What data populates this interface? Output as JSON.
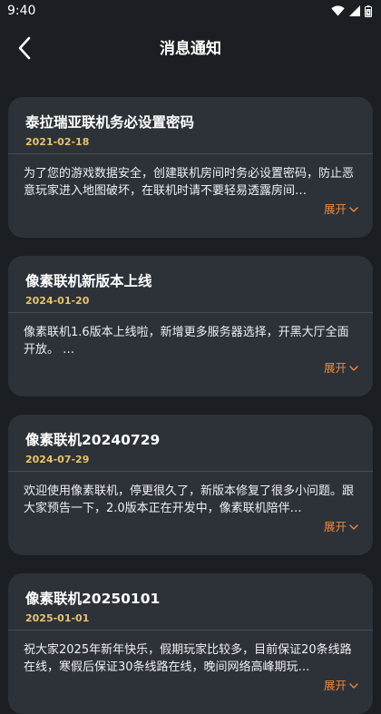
{
  "status_bar": {
    "time": "9:40",
    "icons": [
      "wifi-icon",
      "signal-icon",
      "battery-icon"
    ]
  },
  "header": {
    "title": "消息通知",
    "back_icon": "chevron-left-icon"
  },
  "colors": {
    "background": "#1b1e22",
    "card": "#2c3238",
    "date": "#e8c36a",
    "expand": "#f0883a"
  },
  "notifications": [
    {
      "title": "泰拉瑞亚联机务必设置密码",
      "date": "2021-02-18",
      "body": "为了您的游戏数据安全，创建联机房间时务必设置密码，防止恶意玩家进入地图破坏，在联机时请不要轻易透露房间…",
      "expand_label": "展开"
    },
    {
      "title": "像素联机新版本上线",
      "date": "2024-01-20",
      "body": "像素联机1.6版本上线啦，新增更多服务器选择，开黑大厅全面开放。 …",
      "expand_label": "展开"
    },
    {
      "title": "像素联机20240729",
      "date": "2024-07-29",
      "body": "欢迎使用像素联机，停更很久了，新版本修复了很多小问题。跟大家预告一下，2.0版本正在开发中，像素联机陪伴…",
      "expand_label": "展开"
    },
    {
      "title": "像素联机20250101",
      "date": "2025-01-01",
      "body": "祝大家2025年新年快乐，假期玩家比较多，目前保证20条线路在线，寒假后保证30条线路在线，晚间网络高峰期玩…",
      "expand_label": "展开"
    }
  ]
}
